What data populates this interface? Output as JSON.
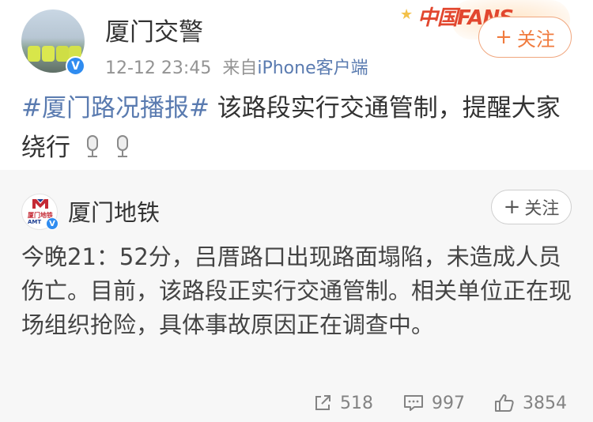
{
  "post": {
    "username": "厦门交警",
    "time": "12-12 23:45",
    "source_prefix": "来自",
    "source": "iPhone客户端",
    "fans_badge": "中国FANS",
    "follow_label": "关注",
    "topic": "#厦门路况播报#",
    "text": " 该路段实行交通管制，提醒大家绕行"
  },
  "repost": {
    "avatar_text": "厦门地铁",
    "avatar_sub": "AMT",
    "username": "厦门地铁",
    "follow_label": "关注",
    "text": "今晚21：52分，吕厝路口出现路面塌陷，未造成人员伤亡。目前，该路段正实行交通管制。相关单位正在现场组织抢险，具体事故原因正在调查中。",
    "actions": {
      "share_count": "518",
      "comment_count": "997",
      "like_count": "3854"
    }
  },
  "icons": {
    "verified": "verified-v-icon",
    "share": "share-icon",
    "comment": "comment-icon",
    "like": "thumbs-up-icon",
    "mic": "microphone-emoji-icon"
  },
  "colors": {
    "topic_link": "#5a7bb0",
    "follow_orange": "#f07b3e",
    "verified_blue": "#2f8cf0",
    "repost_bg": "#f7f7f7"
  }
}
